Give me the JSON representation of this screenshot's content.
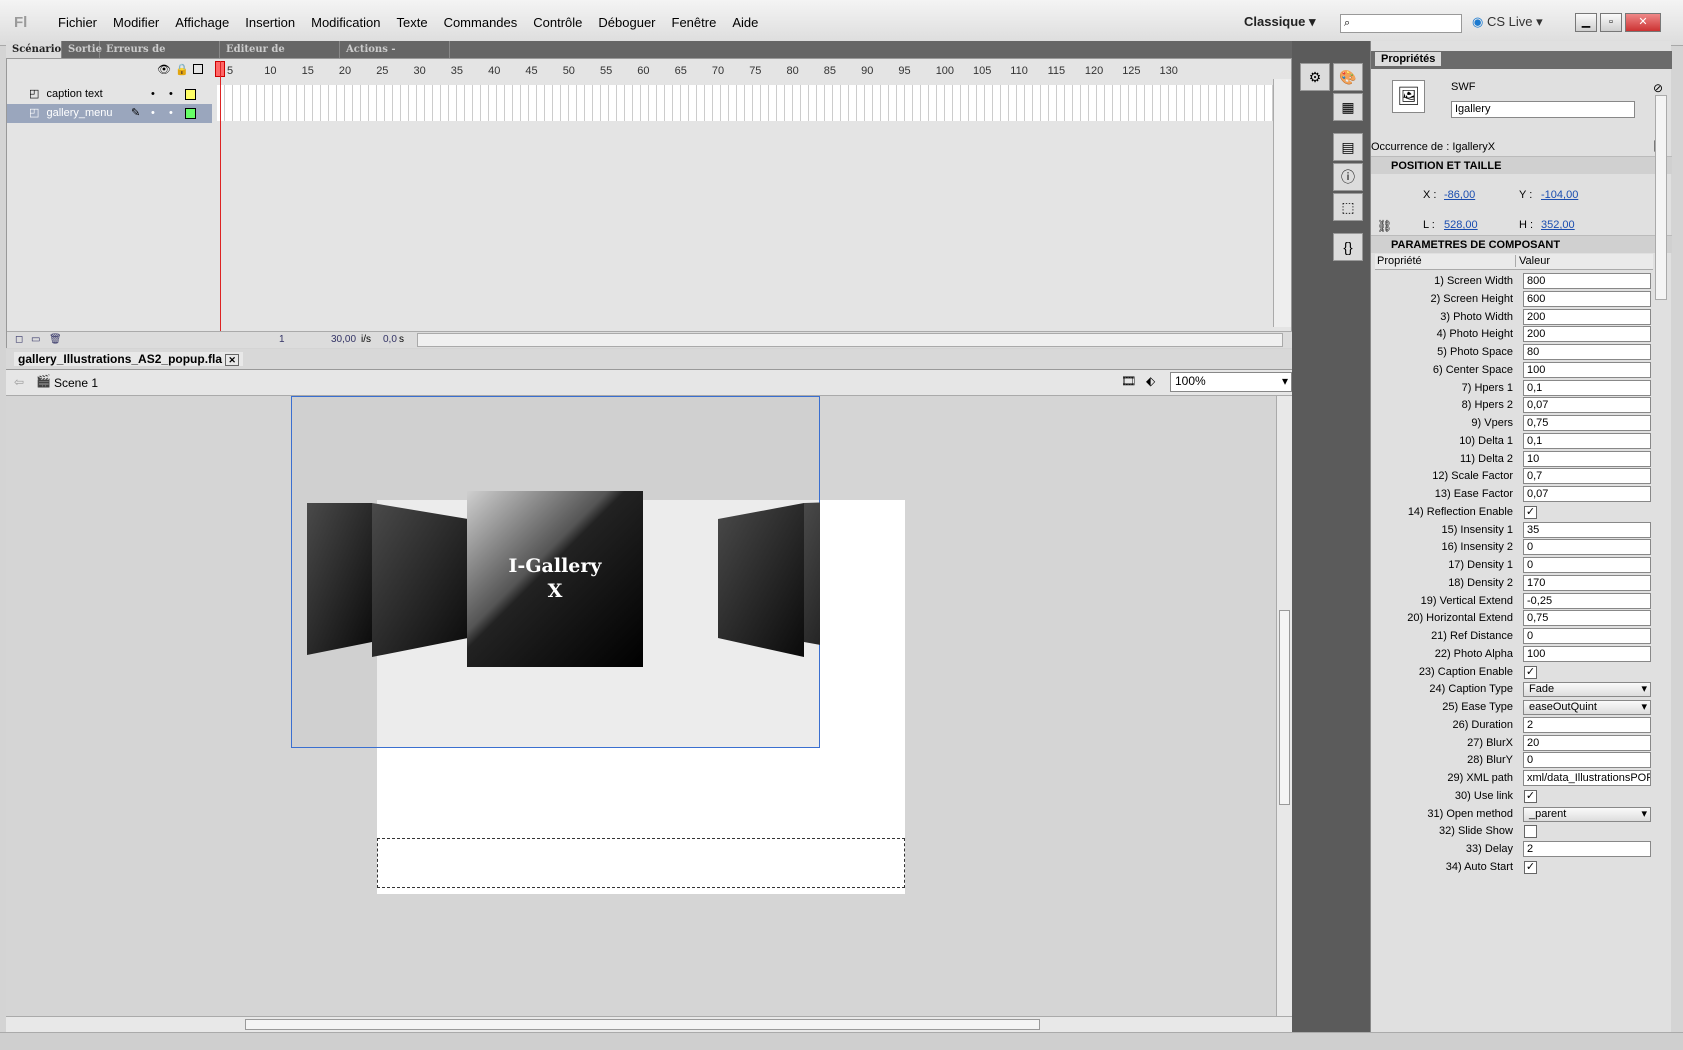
{
  "app": {
    "logo": "Fl"
  },
  "menu": [
    "Fichier",
    "Modifier",
    "Affichage",
    "Insertion",
    "Modification",
    "Texte",
    "Commandes",
    "Contrôle",
    "Déboguer",
    "Fenêtre",
    "Aide"
  ],
  "workspace": "Classique",
  "cslive": "CS Live",
  "panel_tabs": [
    "Scénario",
    "Sortie",
    "Erreurs de compilation",
    "Editeur de mouvement",
    "Actions - Composant"
  ],
  "layers": [
    {
      "name": "caption text",
      "color": "#ffff66"
    },
    {
      "name": "gallery_menu",
      "color": "#66ff66"
    }
  ],
  "ruler": [
    "5",
    "10",
    "15",
    "20",
    "25",
    "30",
    "35",
    "40",
    "45",
    "50",
    "55",
    "60",
    "65",
    "70",
    "75",
    "80",
    "85",
    "90",
    "95",
    "100",
    "105",
    "110",
    "115",
    "120",
    "125",
    "130"
  ],
  "timeline_status": {
    "frame": "1",
    "fps": "30,00",
    "fps_unit": "i/s",
    "time": "0,0",
    "time_unit": "s"
  },
  "document": {
    "tab": "gallery_Illustrations_AS2_popup.fla",
    "scene": "Scene 1",
    "zoom": "100%"
  },
  "gallery": {
    "title1": "I-Gallery",
    "title2": "X"
  },
  "props": {
    "title": "Propriétés",
    "type": "SWF",
    "instance": "Igallery",
    "occurrence": "Occurrence de : IgalleryX",
    "sec_position": "POSITION ET TAILLE",
    "x_label": "X :",
    "x": "-86,00",
    "y_label": "Y :",
    "y": "-104,00",
    "w_label": "L :",
    "w": "528,00",
    "h_label": "H :",
    "h": "352,00",
    "sec_params": "PARAMETRES DE COMPOSANT",
    "col_prop": "Propriété",
    "col_val": "Valeur",
    "rows": [
      {
        "n": "1) Screen Width",
        "v": "800",
        "t": "text"
      },
      {
        "n": "2) Screen Height",
        "v": "600",
        "t": "text"
      },
      {
        "n": "3) Photo Width",
        "v": "200",
        "t": "text"
      },
      {
        "n": "4) Photo Height",
        "v": "200",
        "t": "text"
      },
      {
        "n": "5) Photo Space",
        "v": "80",
        "t": "text"
      },
      {
        "n": "6) Center Space",
        "v": "100",
        "t": "text"
      },
      {
        "n": "7) Hpers 1",
        "v": "0,1",
        "t": "text"
      },
      {
        "n": "8) Hpers 2",
        "v": "0,07",
        "t": "text"
      },
      {
        "n": "9) Vpers",
        "v": "0,75",
        "t": "text"
      },
      {
        "n": "10) Delta 1",
        "v": "0,1",
        "t": "text"
      },
      {
        "n": "11) Delta 2",
        "v": "10",
        "t": "text"
      },
      {
        "n": "12) Scale Factor",
        "v": "0,7",
        "t": "text"
      },
      {
        "n": "13) Ease Factor",
        "v": "0,07",
        "t": "text"
      },
      {
        "n": "14) Reflection Enable",
        "v": "✓",
        "t": "check"
      },
      {
        "n": "15) Insensity 1",
        "v": "35",
        "t": "text"
      },
      {
        "n": "16) Insensity 2",
        "v": "0",
        "t": "text"
      },
      {
        "n": "17) Density 1",
        "v": "0",
        "t": "text"
      },
      {
        "n": "18) Density 2",
        "v": "170",
        "t": "text"
      },
      {
        "n": "19) Vertical Extend",
        "v": "-0,25",
        "t": "text"
      },
      {
        "n": "20) Horizontal Extend",
        "v": "0,75",
        "t": "text"
      },
      {
        "n": "21) Ref Distance",
        "v": "0",
        "t": "text"
      },
      {
        "n": "22) Photo Alpha",
        "v": "100",
        "t": "text"
      },
      {
        "n": "23) Caption Enable",
        "v": "✓",
        "t": "check"
      },
      {
        "n": "24) Caption Type",
        "v": "Fade",
        "t": "select"
      },
      {
        "n": "25) Ease Type",
        "v": "easeOutQuint",
        "t": "select"
      },
      {
        "n": "26) Duration",
        "v": "2",
        "t": "text"
      },
      {
        "n": "27) BlurX",
        "v": "20",
        "t": "text"
      },
      {
        "n": "28) BlurY",
        "v": "0",
        "t": "text"
      },
      {
        "n": "29) XML path",
        "v": "xml/data_IllustrationsPOP",
        "t": "text"
      },
      {
        "n": "30) Use link",
        "v": "✓",
        "t": "check"
      },
      {
        "n": "31) Open method",
        "v": "_parent",
        "t": "select"
      },
      {
        "n": "32) Slide Show",
        "v": "",
        "t": "check"
      },
      {
        "n": "33) Delay",
        "v": "2",
        "t": "text"
      },
      {
        "n": "34) Auto Start",
        "v": "✓",
        "t": "check"
      }
    ]
  }
}
